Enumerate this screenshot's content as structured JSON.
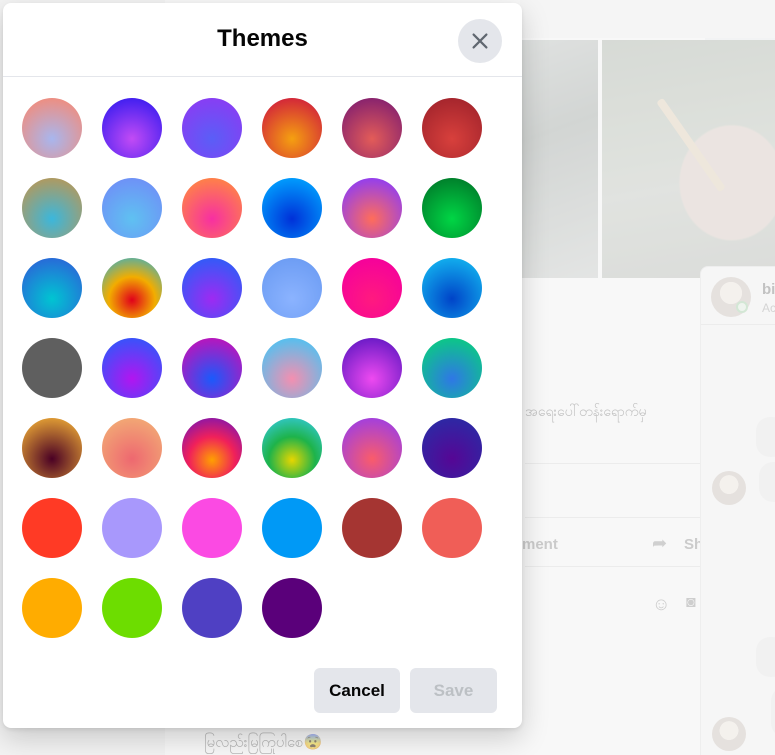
{
  "dialog": {
    "title": "Themes",
    "close_icon": "close-icon",
    "cancel_label": "Cancel",
    "save_label": "Save",
    "save_disabled": true
  },
  "themes": [
    {
      "name": "theme-1",
      "colors": [
        "#a8b6ee",
        "#f18c7c"
      ]
    },
    {
      "name": "theme-2",
      "colors": [
        "#c24bf5",
        "#3b1df0"
      ]
    },
    {
      "name": "theme-3",
      "colors": [
        "#5a5ef7",
        "#8a3cf3"
      ]
    },
    {
      "name": "theme-4",
      "colors": [
        "#f5a010",
        "#d1213b"
      ]
    },
    {
      "name": "theme-5",
      "colors": [
        "#e35c58",
        "#84206f"
      ]
    },
    {
      "name": "theme-6",
      "colors": [
        "#d8403c",
        "#a3242c"
      ]
    },
    {
      "name": "theme-7",
      "colors": [
        "#3bb7dc",
        "#b5985a"
      ]
    },
    {
      "name": "theme-8",
      "colors": [
        "#5fc1f1",
        "#6f8ff7"
      ]
    },
    {
      "name": "theme-9",
      "colors": [
        "#f72fa2",
        "#ff8544"
      ]
    },
    {
      "name": "theme-10",
      "colors": [
        "#0030d8",
        "#00a1ff"
      ]
    },
    {
      "name": "theme-11",
      "colors": [
        "#ff6d5a",
        "#8e3cf5"
      ]
    },
    {
      "name": "theme-12",
      "colors": [
        "#00d645",
        "#007c2a"
      ]
    },
    {
      "name": "theme-13",
      "colors": [
        "#00c5d2",
        "#2a66d8"
      ]
    },
    {
      "name": "theme-14",
      "colors": [
        "#e0001b",
        "#f2ad00",
        "#1eb0df"
      ]
    },
    {
      "name": "theme-15",
      "colors": [
        "#9e2af2",
        "#2d5df8"
      ]
    },
    {
      "name": "theme-16",
      "colors": [
        "#8bb3ff",
        "#6c9cf3"
      ]
    },
    {
      "name": "theme-17",
      "colors": [
        "#ff1a7f",
        "#f5009c"
      ]
    },
    {
      "name": "theme-18",
      "colors": [
        "#0043c8",
        "#12b2ef"
      ]
    },
    {
      "name": "theme-19",
      "colors": [
        "#5f5f5f",
        "#5f5f5f"
      ]
    },
    {
      "name": "theme-20",
      "colors": [
        "#b215f0",
        "#3256fb"
      ]
    },
    {
      "name": "theme-21",
      "colors": [
        "#1a5afc",
        "#c012b9"
      ]
    },
    {
      "name": "theme-22",
      "colors": [
        "#f48fb0",
        "#4ec2f2"
      ]
    },
    {
      "name": "theme-23",
      "colors": [
        "#ee4af0",
        "#6619c5"
      ]
    },
    {
      "name": "theme-24",
      "colors": [
        "#2f77e6",
        "#0acb82"
      ]
    },
    {
      "name": "theme-25",
      "colors": [
        "#4a0024",
        "#e5a235"
      ]
    },
    {
      "name": "theme-26",
      "colors": [
        "#ee6870",
        "#f2aa75"
      ]
    },
    {
      "name": "theme-27",
      "colors": [
        "#ffa000",
        "#f0205a",
        "#6312c6"
      ]
    },
    {
      "name": "theme-28",
      "colors": [
        "#e7d600",
        "#1eb34a",
        "#39cef5"
      ]
    },
    {
      "name": "theme-29",
      "colors": [
        "#fa5c6a",
        "#9f3ee2"
      ]
    },
    {
      "name": "theme-30",
      "colors": [
        "#560695",
        "#2b2aa5"
      ]
    },
    {
      "name": "theme-31",
      "colors": [
        "#ff3a25",
        "#ff3a25"
      ]
    },
    {
      "name": "theme-32",
      "colors": [
        "#a898fc",
        "#a898fc"
      ]
    },
    {
      "name": "theme-33",
      "colors": [
        "#fb4ae3",
        "#fb4ae3"
      ]
    },
    {
      "name": "theme-34",
      "colors": [
        "#0099f6",
        "#0099f6"
      ]
    },
    {
      "name": "theme-35",
      "colors": [
        "#a53532",
        "#a53532"
      ]
    },
    {
      "name": "theme-36",
      "colors": [
        "#f05e57",
        "#f05e57"
      ]
    },
    {
      "name": "theme-37",
      "colors": [
        "#ffac00",
        "#ffac00"
      ]
    },
    {
      "name": "theme-38",
      "colors": [
        "#6ddd00",
        "#6ddd00"
      ]
    },
    {
      "name": "theme-39",
      "colors": [
        "#4f40c3",
        "#4f40c3"
      ]
    },
    {
      "name": "theme-40",
      "colors": [
        "#5a007a",
        "#5a007a"
      ]
    }
  ],
  "background": {
    "post_text": "အရေးပေါ်တန်းရောက်မှ",
    "comment_label": "ment",
    "share_label": "Sh",
    "bottom_text": "မြလည်းမြကြုပါစေ😨",
    "chat_name": "bi",
    "chat_sub": "Ac"
  }
}
